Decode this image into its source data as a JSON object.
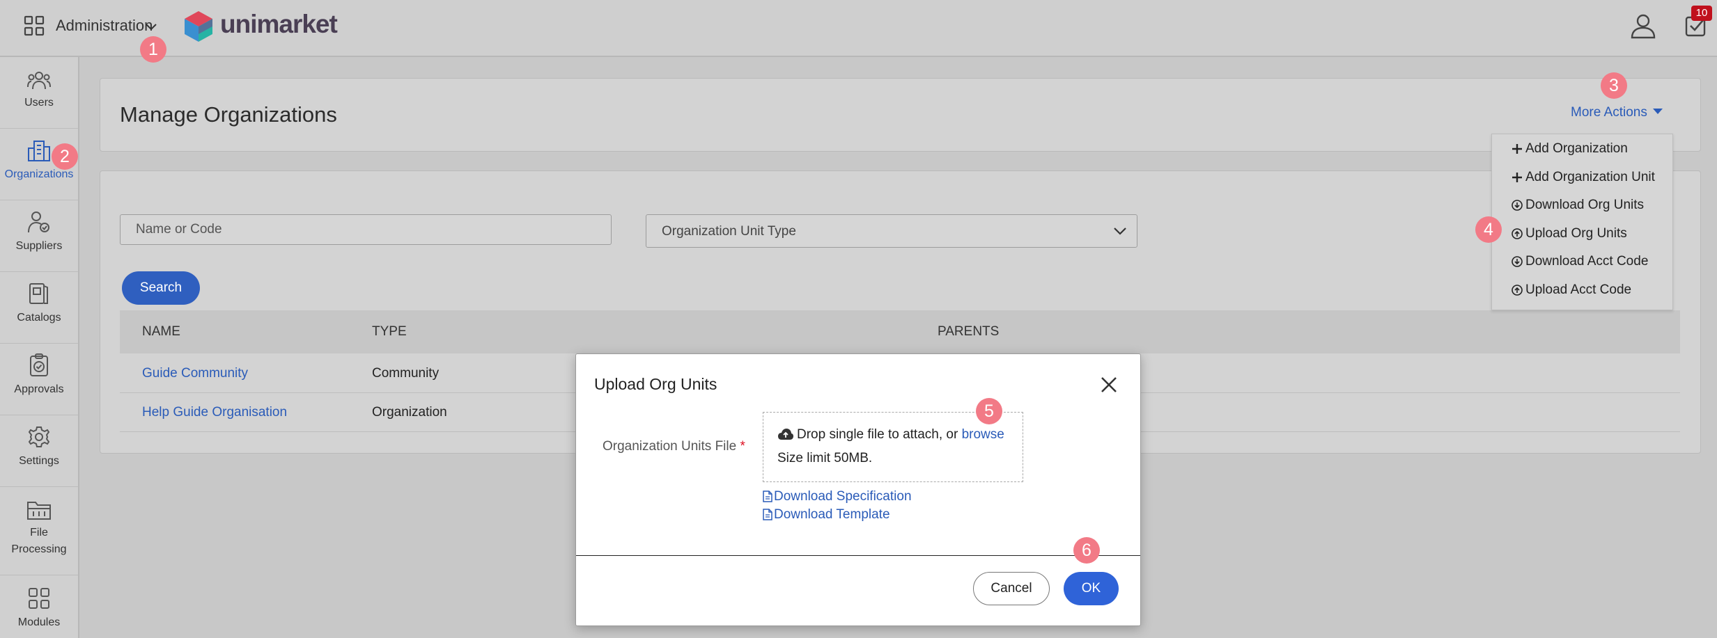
{
  "topbar": {
    "app_menu_label": "Administration",
    "brand": "unimarket",
    "tasks_badge": "10"
  },
  "sidebar": {
    "items": [
      {
        "label": "Users",
        "icon": "users-icon"
      },
      {
        "label": "Organizations",
        "icon": "buildings-icon",
        "active": true
      },
      {
        "label": "Suppliers",
        "icon": "supplier-icon"
      },
      {
        "label": "Catalogs",
        "icon": "catalog-icon"
      },
      {
        "label": "Approvals",
        "icon": "approval-icon"
      },
      {
        "label": "Settings",
        "icon": "gear-icon"
      },
      {
        "label": "File Processing",
        "icon": "folder-icon"
      },
      {
        "label": "Modules",
        "icon": "modules-icon"
      }
    ]
  },
  "header": {
    "title": "Manage Organizations",
    "more_actions": "More Actions"
  },
  "more_actions_menu": {
    "items": [
      {
        "label": "Add Organization",
        "icon": "plus-icon"
      },
      {
        "label": "Add Organization Unit",
        "icon": "plus-icon"
      },
      {
        "label": "Download Org Units",
        "icon": "download-circle-icon"
      },
      {
        "label": "Upload Org Units",
        "icon": "upload-circle-icon"
      },
      {
        "label": "Download Acct Code",
        "icon": "download-circle-icon"
      },
      {
        "label": "Upload Acct Code",
        "icon": "upload-circle-icon"
      }
    ]
  },
  "filters": {
    "name_placeholder": "Name or Code",
    "name_value": "",
    "type_placeholder": "Organization Unit Type",
    "search_label": "Search"
  },
  "table": {
    "columns": [
      "NAME",
      "TYPE",
      "PARENTS"
    ],
    "rows": [
      {
        "name": "Guide Community",
        "type": "Community",
        "parents": ""
      },
      {
        "name": "Help Guide Organisation",
        "type": "Organization",
        "parents": ""
      }
    ]
  },
  "modal": {
    "title": "Upload Org Units",
    "file_label": "Organization Units File",
    "required_mark": "*",
    "drop_text": "Drop single file to attach, or",
    "browse_text": "browse",
    "size_limit": "Size limit 50MB.",
    "download_spec": "Download Specification",
    "download_template": "Download Template",
    "cancel_label": "Cancel",
    "ok_label": "OK"
  },
  "steps": [
    "1",
    "2",
    "3",
    "4",
    "5",
    "6"
  ],
  "colors": {
    "accent": "#2a5bb8",
    "primary_button": "#2f63d8",
    "step_marker": "#f27a86",
    "badge": "#c0111d"
  }
}
